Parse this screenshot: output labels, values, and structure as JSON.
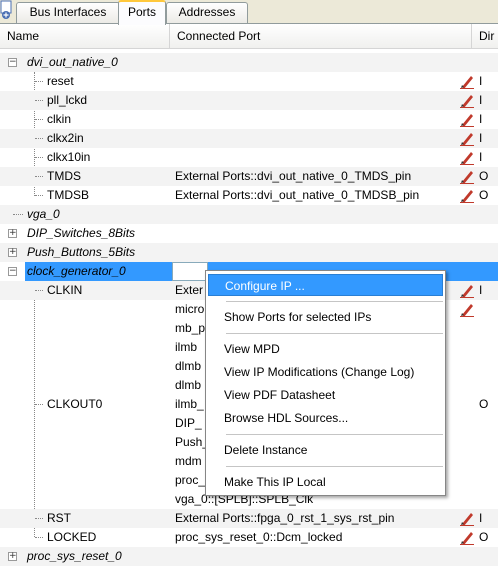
{
  "tabs": [
    {
      "label": "Bus Interfaces"
    },
    {
      "label": "Ports"
    },
    {
      "label": "Addresses"
    }
  ],
  "columns": {
    "name": "Name",
    "connected_port": "Connected Port",
    "dir": "Dir"
  },
  "rows": [
    {
      "name": "dvi_out_native_0",
      "port": "",
      "dir": ""
    },
    {
      "name": "reset",
      "port": "",
      "dir": "I"
    },
    {
      "name": "pll_lckd",
      "port": "",
      "dir": "I"
    },
    {
      "name": "clkin",
      "port": "",
      "dir": "I"
    },
    {
      "name": "clkx2in",
      "port": "",
      "dir": "I"
    },
    {
      "name": "clkx10in",
      "port": "",
      "dir": "I"
    },
    {
      "name": "TMDS",
      "port": "External Ports::dvi_out_native_0_TMDS_pin",
      "dir": "O"
    },
    {
      "name": "TMDSB",
      "port": "External Ports::dvi_out_native_0_TMDSB_pin",
      "dir": "O"
    },
    {
      "name": "vga_0",
      "port": "",
      "dir": ""
    },
    {
      "name": "DIP_Switches_8Bits",
      "port": "",
      "dir": ""
    },
    {
      "name": "Push_Buttons_5Bits",
      "port": "",
      "dir": ""
    },
    {
      "name": "clock_generator_0",
      "port": "",
      "dir": ""
    },
    {
      "name": "CLKIN",
      "port": "Exter",
      "dir": "I"
    },
    {
      "name": "",
      "port": "micro",
      "dir": ""
    },
    {
      "name": "",
      "port": "mb_p",
      "dir": ""
    },
    {
      "name": "",
      "port": "ilmb",
      "dir": ""
    },
    {
      "name": "",
      "port": "dlmb",
      "dir": ""
    },
    {
      "name": "",
      "port": "dlmb",
      "dir": ""
    },
    {
      "name": "CLKOUT0",
      "port": "ilmb_",
      "dir": "O"
    },
    {
      "name": "",
      "port": "DIP_",
      "dir": ""
    },
    {
      "name": "",
      "port": "Push_",
      "dir": ""
    },
    {
      "name": "",
      "port": "mdm",
      "dir": ""
    },
    {
      "name": "",
      "port": "proc_",
      "dir": ""
    },
    {
      "name": "",
      "port": "vga_0::[SPLB]::SPLB_Clk",
      "dir": ""
    },
    {
      "name": "RST",
      "port": "External Ports::fpga_0_rst_1_sys_rst_pin",
      "dir": "I"
    },
    {
      "name": "LOCKED",
      "port": "proc_sys_reset_0::Dcm_locked",
      "dir": "O"
    },
    {
      "name": "proc_sys_reset_0",
      "port": "",
      "dir": ""
    }
  ],
  "expanders": {
    "collapsed": "+",
    "expanded": "−"
  },
  "context_menu": {
    "items": [
      {
        "label": "Configure IP ..."
      },
      {
        "label": "Show Ports for selected IPs"
      },
      {
        "label": "View MPD"
      },
      {
        "label": "View IP Modifications (Change Log)"
      },
      {
        "label": "View PDF Datasheet"
      },
      {
        "label": "Browse HDL Sources..."
      },
      {
        "label": "Delete Instance"
      },
      {
        "label": "Make This IP Local"
      }
    ]
  },
  "colors": {
    "selection": "#3399ff",
    "pencil": "#c0392b",
    "tab_active_accent": "#ffc83c"
  }
}
